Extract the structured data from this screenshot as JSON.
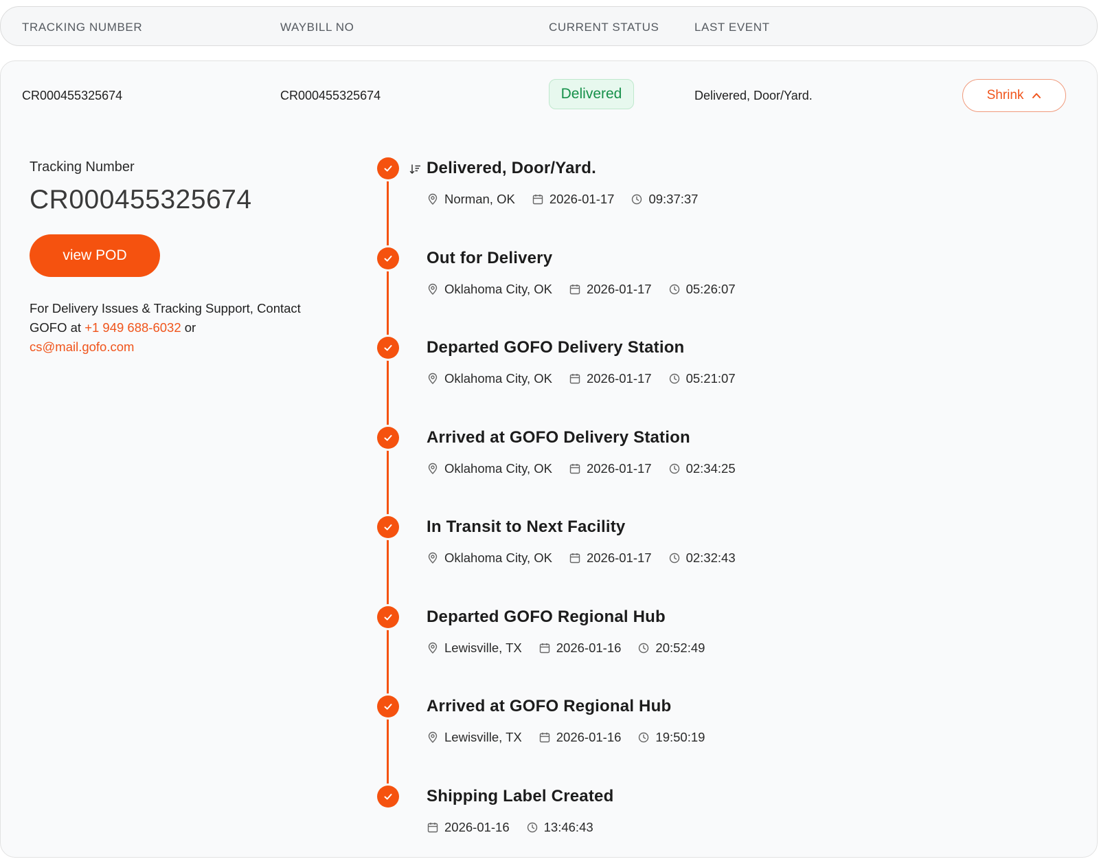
{
  "header": {
    "col_tracking": "TRACKING NUMBER",
    "col_waybill": "WAYBILL NO",
    "col_status": "CURRENT STATUS",
    "col_last_event": "LAST EVENT"
  },
  "row": {
    "tracking_number": "CR000455325674",
    "waybill_no": "CR000455325674",
    "status": "Delivered",
    "last_event": "Delivered, Door/Yard.",
    "shrink_label": "Shrink"
  },
  "detail": {
    "tracking_label": "Tracking Number",
    "tracking_number": "CR000455325674",
    "pod_button": "view POD",
    "support_text_1": "For Delivery Issues & Tracking Support, Contact GOFO at ",
    "support_phone": "+1 949 688-6032",
    "support_text_2": " or ",
    "support_email": "cs@mail.gofo.com"
  },
  "events": [
    {
      "title": "Delivered, Door/Yard.",
      "location": "Norman, OK",
      "date": "2026-01-17",
      "time": "09:37:37"
    },
    {
      "title": "Out for Delivery",
      "location": "Oklahoma City, OK",
      "date": "2026-01-17",
      "time": "05:26:07"
    },
    {
      "title": "Departed GOFO Delivery Station",
      "location": "Oklahoma City, OK",
      "date": "2026-01-17",
      "time": "05:21:07"
    },
    {
      "title": "Arrived at GOFO Delivery Station",
      "location": "Oklahoma City, OK",
      "date": "2026-01-17",
      "time": "02:34:25"
    },
    {
      "title": "In Transit to Next Facility",
      "location": "Oklahoma City, OK",
      "date": "2026-01-17",
      "time": "02:32:43"
    },
    {
      "title": "Departed GOFO Regional Hub",
      "location": "Lewisville, TX",
      "date": "2026-01-16",
      "time": "20:52:49"
    },
    {
      "title": "Arrived at GOFO Regional Hub",
      "location": "Lewisville, TX",
      "date": "2026-01-16",
      "time": "19:50:19"
    },
    {
      "title": "Shipping Label Created",
      "date": "2026-01-16",
      "time": "13:46:43"
    }
  ],
  "colors": {
    "accent": "#f5520f",
    "delivered_text": "#16904a",
    "delivered_bg": "#e7f8ee"
  },
  "icons": {
    "location": "map-pin-icon",
    "date": "calendar-icon",
    "time": "clock-icon",
    "check": "check-icon",
    "sort": "sort-icon",
    "chevron": "chevron-up-icon"
  }
}
